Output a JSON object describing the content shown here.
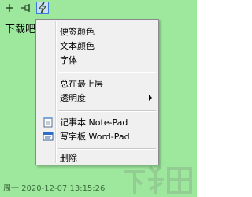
{
  "colors": {
    "note_background": "#9ee89e",
    "menu_background": "#f0f0f0",
    "active_button_border": "#3a7bd5"
  },
  "toolbar": {
    "buttons": [
      {
        "icon": "new-note-plus-icon"
      },
      {
        "icon": "pin-icon"
      },
      {
        "icon": "lightning-icon",
        "active": true
      }
    ]
  },
  "note": {
    "text": "下载吧",
    "status": "周一 2020-12-07 13:15:26"
  },
  "context_menu": {
    "items": {
      "note_color": "便签颜色",
      "text_color": "文本颜色",
      "font": "字体",
      "always_on_top": "总在最上层",
      "transparency": "透明度",
      "notepad": "记事本 Note-Pad",
      "wordpad": "写字板 Word-Pad",
      "delete": "删除"
    }
  },
  "watermark": "下载吧"
}
